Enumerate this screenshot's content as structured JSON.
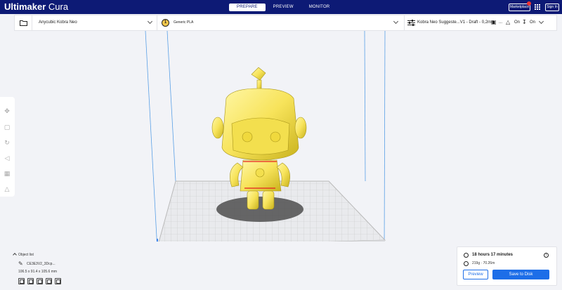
{
  "header": {
    "brand_bold": "Ultimaker",
    "brand_light": "Cura",
    "tabs": [
      {
        "label": "PREPARE",
        "active": true
      },
      {
        "label": "PREVIEW",
        "active": false
      },
      {
        "label": "MONITOR",
        "active": false
      }
    ],
    "marketplace_label": "Marketplace",
    "signin_label": "Sign In",
    "accent_color": "#0d1a75"
  },
  "toolbar": {
    "printer_name": "Anycubic Kobra Neo",
    "extruder_number": "1",
    "material_name": "Generic PLA",
    "profile_summary": "Kobra Neo Suggeste...V1 - Draft - 0,2mm",
    "support_value": "...",
    "adhesion_label": "On",
    "infill_label": "On"
  },
  "object_list": {
    "header": "Object list",
    "object_name": "CE3E3V2_3Dcp...",
    "dimensions": "106.5 x 91.4 x 105.6 mm"
  },
  "print_info": {
    "time": "18 hours 17 minutes",
    "material_usage": "219g · 70.26m",
    "preview_label": "Preview",
    "save_label": "Save to Disk",
    "button_color": "#1d6ee8"
  },
  "left_tools": [
    {
      "icon": "move-icon"
    },
    {
      "icon": "scale-icon"
    },
    {
      "icon": "rotate-icon"
    },
    {
      "icon": "mirror-icon"
    },
    {
      "icon": "per-model-settings-icon"
    },
    {
      "icon": "support-blocker-icon"
    }
  ]
}
